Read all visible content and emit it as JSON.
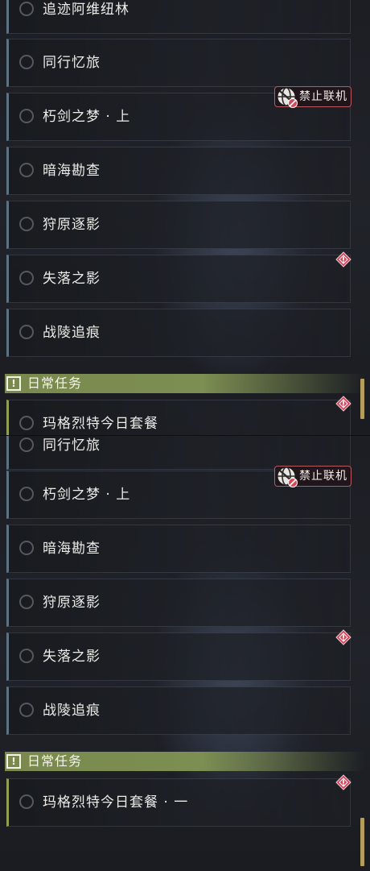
{
  "top_view": {
    "quests": [
      {
        "label": "追迹阿维纽林"
      },
      {
        "label": "同行忆旅"
      },
      {
        "label": "朽剑之梦 · 上"
      },
      {
        "label": "暗海勘查"
      },
      {
        "label": "狩原逐影"
      },
      {
        "label": "失落之影"
      },
      {
        "label": "战陵追痕"
      }
    ],
    "badge_label": "禁止联机",
    "section_title": "日常任务",
    "partial_item": "玛格烈特今日套餐"
  },
  "bottom_view": {
    "quests": [
      {
        "label": "同行忆旅"
      },
      {
        "label": "朽剑之梦 · 上"
      },
      {
        "label": "暗海勘查"
      },
      {
        "label": "狩原逐影"
      },
      {
        "label": "失落之影"
      },
      {
        "label": "战陵追痕"
      }
    ],
    "badge_label": "禁止联机",
    "section_title": "日常任务",
    "daily_quest": "玛格烈特今日套餐 · 一"
  },
  "icons": {
    "quest_status": "empty-circle-icon",
    "multiplayer_disabled": "globe-prohibited-icon",
    "warning": "diamond-alert-icon",
    "section": "exclamation-box-icon"
  },
  "colors": {
    "daily_accent": "#7d8e52",
    "warning": "#d2455a",
    "badge_border": "#b8585f",
    "scrollbar": "#b49d5a"
  }
}
